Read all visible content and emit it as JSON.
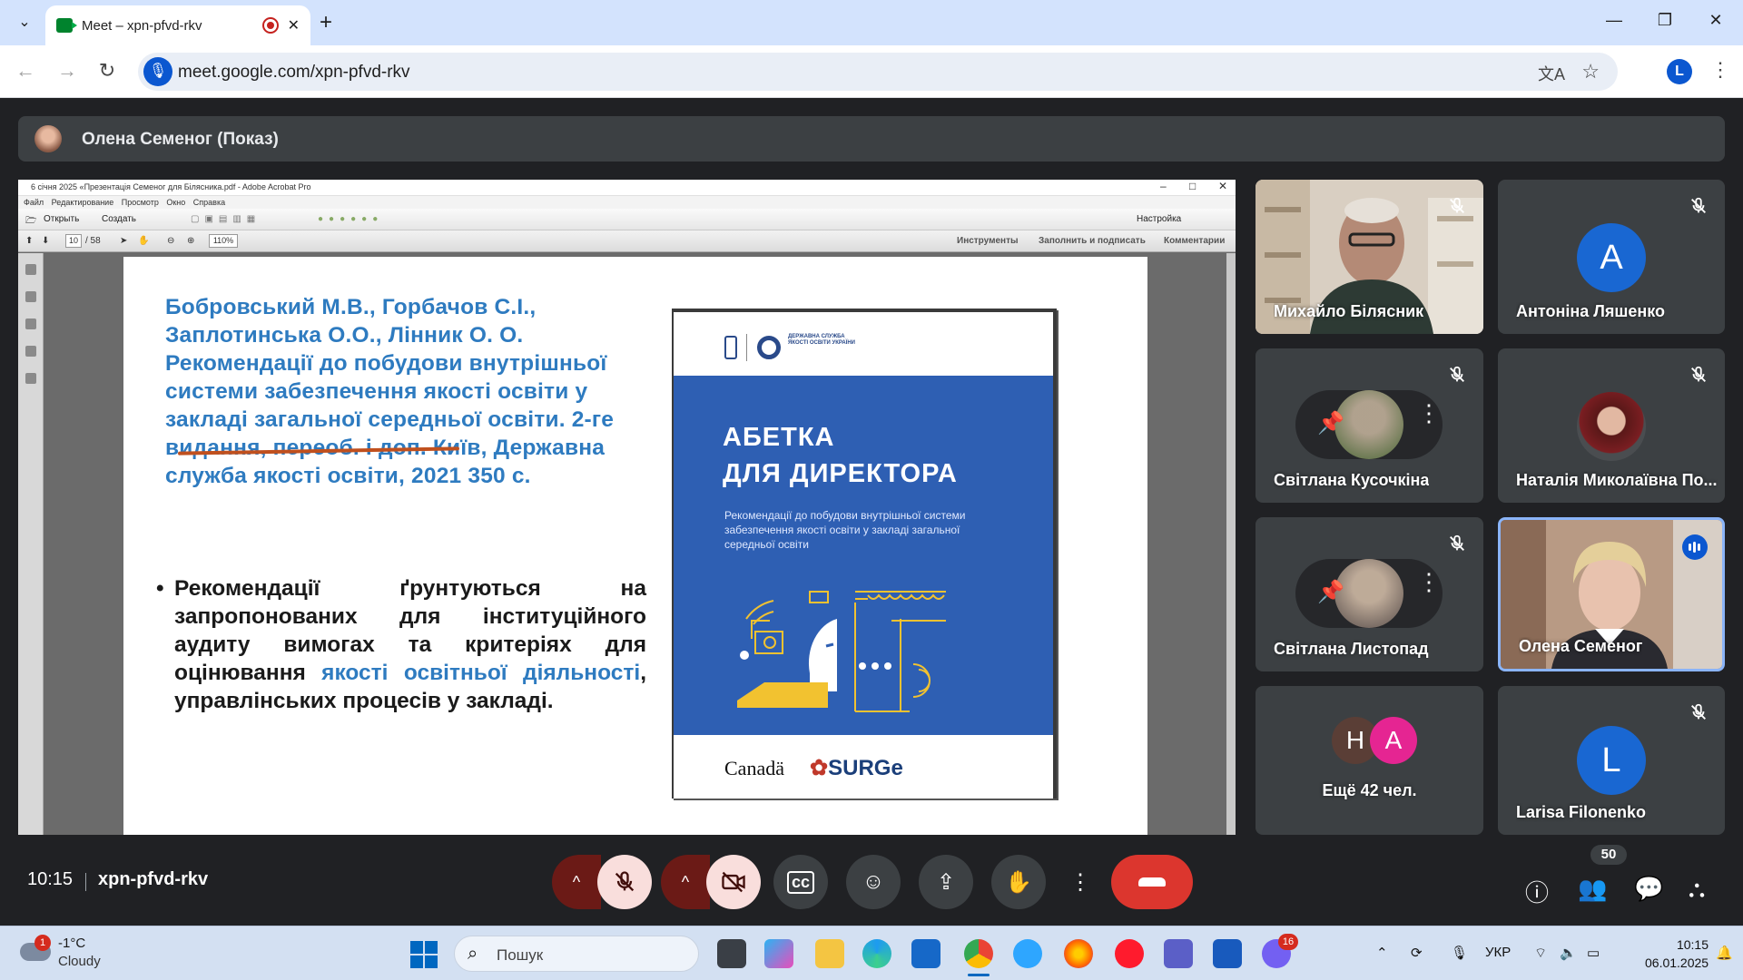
{
  "browser": {
    "tab_title": "Meet – xpn-pfvd-rkv",
    "url": "meet.google.com/xpn-pfvd-rkv",
    "profile_initial": "L"
  },
  "meet": {
    "presenter_label": "Олена Семеног (Показ)",
    "clock": "10:15",
    "meeting_code": "xpn-pfvd-rkv",
    "participant_count": "50",
    "participants": [
      {
        "name": "Михайло Білясник",
        "muted": true
      },
      {
        "name": "Антоніна Ляшенко",
        "initial": "A",
        "muted": true
      },
      {
        "name": "Світлана Кусочкіна",
        "muted": true
      },
      {
        "name": "Наталія Миколаївна По...",
        "muted": true
      },
      {
        "name": "Світлана Листопад",
        "muted": true
      },
      {
        "name": "Олена Семеног",
        "speaking": true
      },
      {
        "name": "Ещё 42 чел.",
        "initials": [
          "H",
          "A"
        ]
      },
      {
        "name": "Larisa Filonenko",
        "initial": "L",
        "muted": true
      }
    ]
  },
  "acrobat": {
    "window_title": "6 січня 2025 «Презентація Семеног для Білясника.pdf - Adobe Acrobat Pro",
    "menu": [
      "Файл",
      "Редактирование",
      "Просмотр",
      "Окно",
      "Справка"
    ],
    "open_label": "Открыть",
    "create_label": "Создать",
    "settings_label": "Настройка",
    "page_current": "10",
    "page_total": "/ 58",
    "zoom": "110%",
    "tools_label": "Инструменты",
    "fill_sign_label": "Заполнить и подписать",
    "comments_label": "Комментарии"
  },
  "slide": {
    "citation": "Бобровський М.В., Горбачов С.І., Заплотинська О.О., Лінник О. О. Рекомендації до побудови внутрішньої системи забезпечення якості освіти у закладі загальної середньої освіти.  2-ге видання, переоб. і доп. Київ, Державна служба якості освіти, 2021  350 с.",
    "bullet_part1": "Рекомендації ґрунтуються на запропонованих для інституційного аудиту вимогах та критеріях для оцінювання ",
    "bullet_highlight": "якості освітньої діяльності",
    "bullet_part2": ", управлінських процесів у закладі.",
    "book_org": "ДЕРЖАВНА СЛУЖБА ЯКОСТІ ОСВІТИ УКРАЇНИ",
    "book_title_line1": "АБЕТКА",
    "book_title_line2": "ДЛЯ ДИРЕКТОРА",
    "book_subtitle": "Рекомендації до побудови внутрішньої системи забезпечення якості освіти у закладі загальної середньої освіти",
    "book_logo_1": "Canadä",
    "book_logo_2": "SURGe"
  },
  "taskbar": {
    "weather_badge": "1",
    "weather_temp": "-1°C",
    "weather_cond": "Cloudy",
    "search_placeholder": "Пошук",
    "viber_badge": "16",
    "lang": "УКР",
    "time": "10:15",
    "date": "06.01.2025"
  },
  "colors": {
    "meet_bg": "#202124",
    "tile_bg": "#3c4043",
    "accent_blue": "#0b57d0",
    "hangup_red": "#dc362e",
    "mic_off_bg": "#f9dedc",
    "slide_blue": "#2e7bc0",
    "book_blue": "#2e5fb3"
  }
}
